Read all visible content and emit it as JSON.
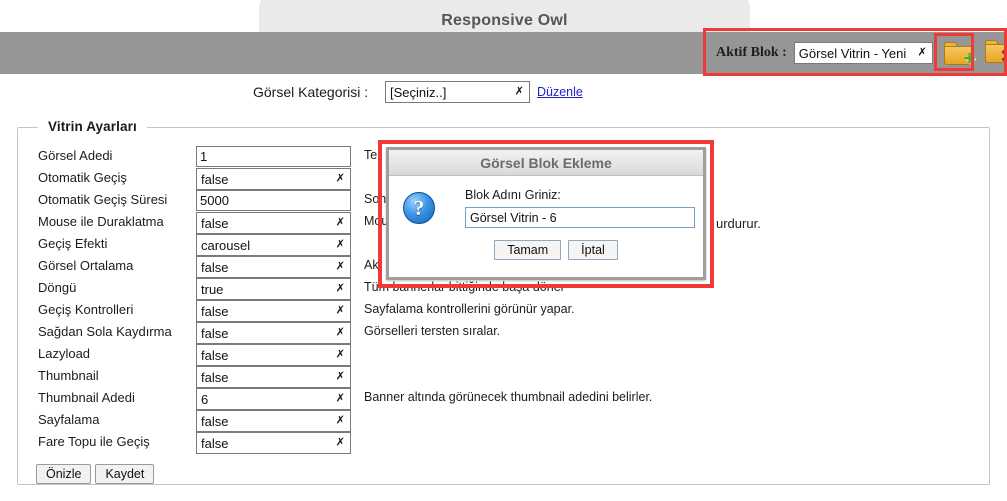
{
  "window": {
    "tab_title": "Responsive Owl"
  },
  "header": {
    "active_block_label": "Aktif Blok :",
    "active_block_value": "Görsel Vitrin - Yeni",
    "add_block_icon": "folder-add-icon",
    "delete_block_icon": "folder-delete-icon"
  },
  "category": {
    "label": "Görsel Kategorisi :",
    "value": "[Seçiniz..]",
    "edit_link": "Düzenle"
  },
  "settings": {
    "legend": "Vitrin Ayarları",
    "rows": [
      {
        "label": "Görsel Adedi",
        "type": "text",
        "value": "1",
        "desc": "Tel"
      },
      {
        "label": "Otomatik Geçiş",
        "type": "select",
        "value": "false",
        "desc": ""
      },
      {
        "label": "Otomatik Geçiş Süresi",
        "type": "text",
        "value": "5000",
        "desc": "Son"
      },
      {
        "label": "Mouse ile Duraklatma",
        "type": "select",
        "value": "false",
        "desc": "Mou"
      },
      {
        "label": "Geçiş Efekti",
        "type": "select",
        "value": "carousel",
        "desc": ""
      },
      {
        "label": "Görsel Ortalama",
        "type": "select",
        "value": "false",
        "desc": "Ak"
      },
      {
        "label": "Döngü",
        "type": "select",
        "value": "true",
        "desc": "Tüm bannerlar bittiğinde başa döner"
      },
      {
        "label": "Geçiş Kontrolleri",
        "type": "select",
        "value": "false",
        "desc": "Sayfalama kontrollerini görünür yapar."
      },
      {
        "label": "Sağdan Sola Kaydırma",
        "type": "select",
        "value": "false",
        "desc": "Görselleri tersten sıralar."
      },
      {
        "label": "Lazyload",
        "type": "select",
        "value": "false",
        "desc": ""
      },
      {
        "label": "Thumbnail",
        "type": "select",
        "value": "false",
        "desc": ""
      },
      {
        "label": "Thumbnail Adedi",
        "type": "select",
        "value": "6",
        "desc": "Banner altında görünecek thumbnail adedini belirler."
      },
      {
        "label": "Sayfalama",
        "type": "select",
        "value": "false",
        "desc": ""
      },
      {
        "label": "Fare Topu ile Geçiş",
        "type": "select",
        "value": "false",
        "desc": ""
      }
    ],
    "preview_button": "Önizle",
    "save_button": "Kaydet"
  },
  "overflow_text": {
    "mouse_desc_tail": "urdurur."
  },
  "modal": {
    "title": "Görsel Blok Ekleme",
    "icon": "question-icon",
    "prompt": "Blok Adını Griniz:",
    "input_value": "Görsel Vitrin - 6",
    "ok_button": "Tamam",
    "cancel_button": "İptal"
  },
  "colors": {
    "band": "#969696",
    "tab": "#eaeaea",
    "highlight": "#ef3b38",
    "link": "#2222cc"
  }
}
